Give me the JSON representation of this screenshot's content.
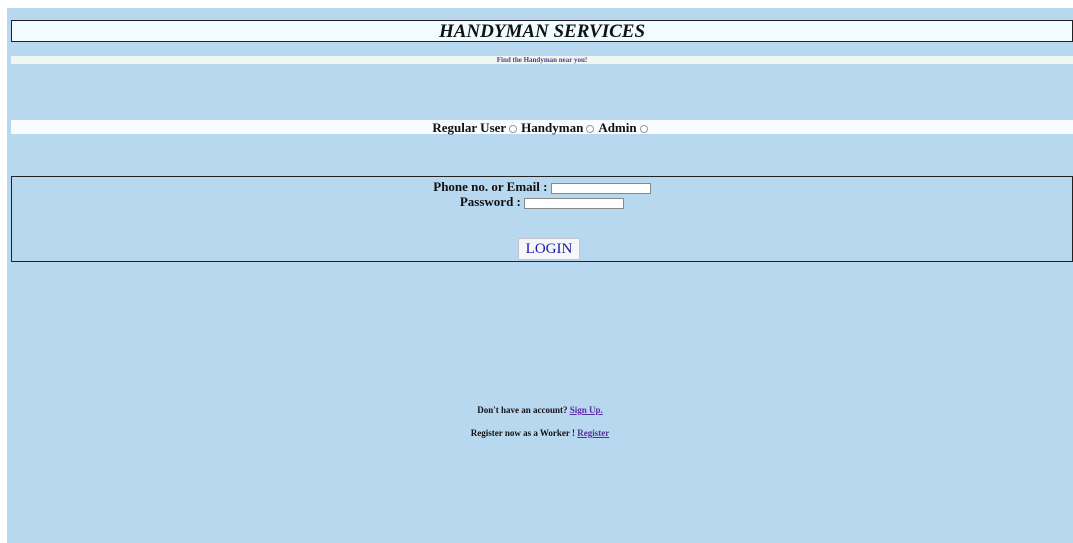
{
  "header": {
    "title": "HANDYMAN SERVICES",
    "tagline": "Find the Handyman near you!"
  },
  "roles": [
    {
      "label": "Regular User",
      "selected": false
    },
    {
      "label": "Handyman",
      "selected": false
    },
    {
      "label": "Admin",
      "selected": false
    }
  ],
  "login_form": {
    "identifier_label": "Phone no. or Email :",
    "identifier_value": "",
    "password_label": "Password :",
    "password_value": "",
    "login_button": "LOGIN"
  },
  "footer": {
    "signup_prompt": "Don't have an account?",
    "signup_link": "Sign Up.",
    "worker_prompt": "Register now as a Worker !",
    "worker_link": "Register"
  },
  "colors": {
    "page_background": "#b8d8f0",
    "title_background": "#f0fcff",
    "link": "#5a2ca0",
    "button_text": "#1a1aaa"
  }
}
